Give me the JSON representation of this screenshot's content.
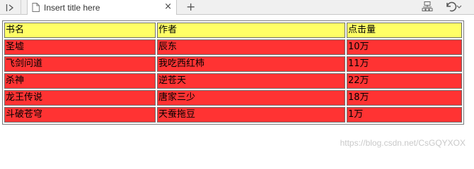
{
  "tab": {
    "title": "Insert title here",
    "close_glyph": "×",
    "new_tab_glyph": "+"
  },
  "icons": [
    "panel-toggle-icon",
    "document-icon",
    "close-icon",
    "plus-icon",
    "outline-icon",
    "undo-icon"
  ],
  "table": {
    "header": [
      "书名",
      "作者",
      "点击量"
    ],
    "rows": [
      [
        "圣墟",
        "辰东",
        "10万"
      ],
      [
        "飞剑问道",
        "我吃西红柿",
        "11万"
      ],
      [
        "杀神",
        "逆苍天",
        "22万"
      ],
      [
        "龙王传说",
        "唐家三少",
        "18万"
      ],
      [
        "斗破苍穹",
        "天蚕拖豆",
        "1万"
      ]
    ]
  },
  "colors": {
    "header_bg": "#ffff66",
    "row_bg": "#ff3333"
  },
  "watermark": "https://blog.csdn.net/CsGQYXOX"
}
